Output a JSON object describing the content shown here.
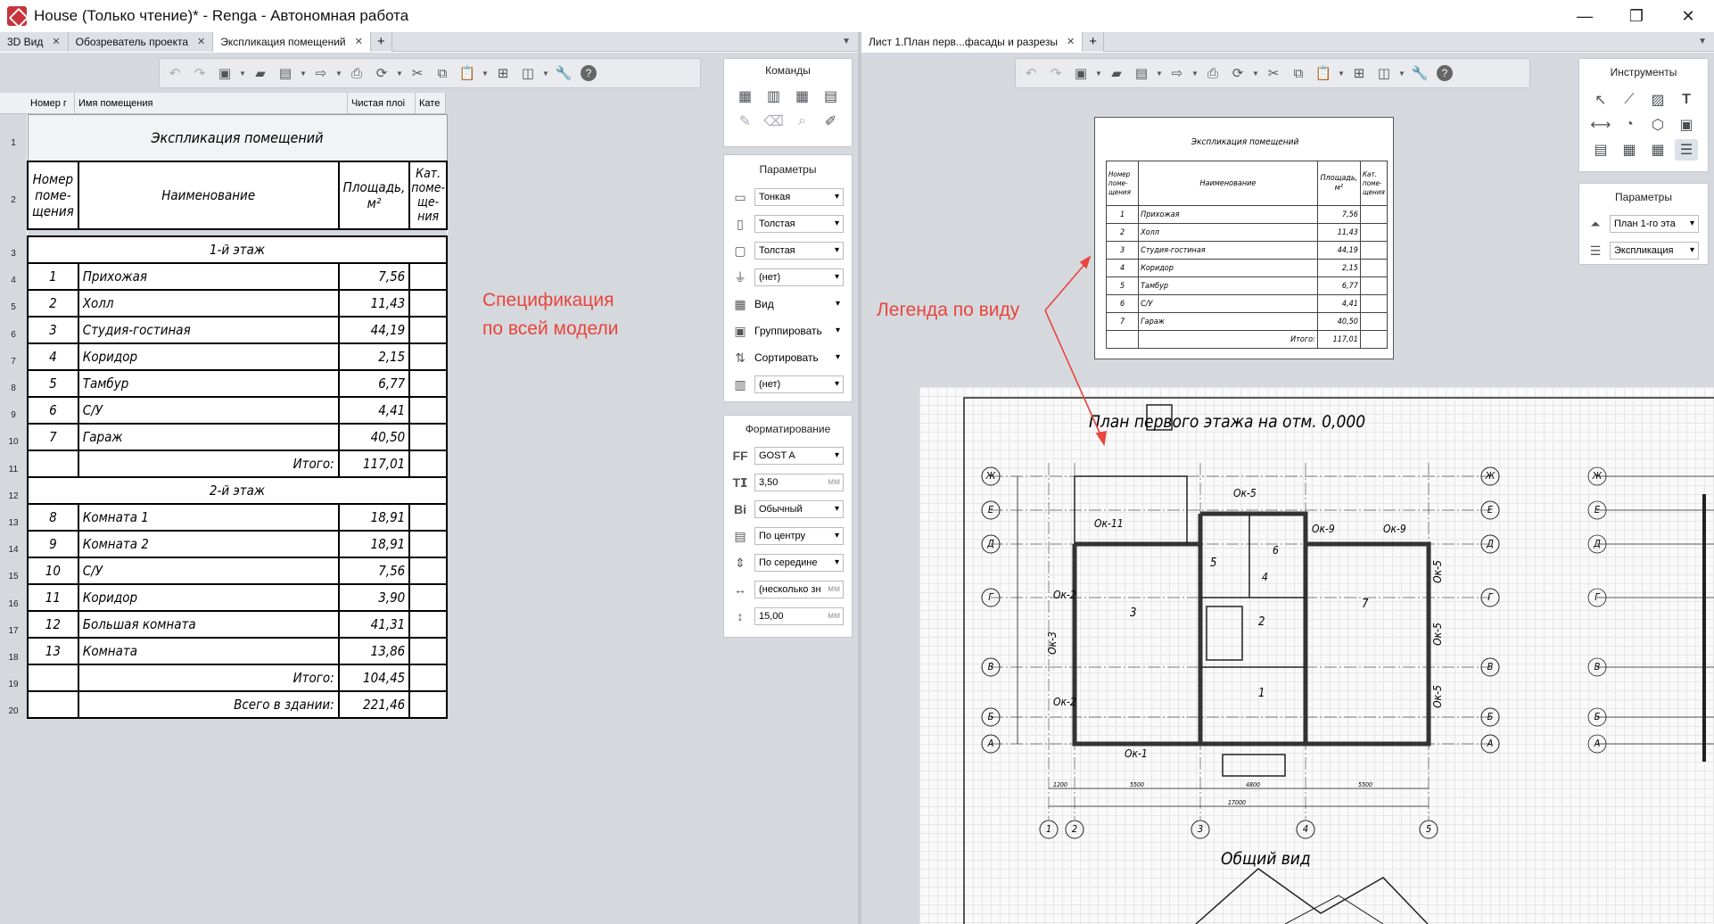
{
  "window": {
    "title": "House (Только чтение)* - Renga - Автономная работа"
  },
  "tabs_left": [
    {
      "label": "3D Вид"
    },
    {
      "label": "Обозреватель проекта"
    },
    {
      "label": "Экспликация помещений"
    }
  ],
  "tabs_right": [
    {
      "label": "Лист 1.План перв...фасады и разрезы"
    }
  ],
  "sheet": {
    "columns": [
      "Номер г",
      "Имя помещения",
      "Чистая плоі",
      "Кате"
    ],
    "row_numbers": [
      "1",
      "2",
      "3",
      "4",
      "5",
      "6",
      "7",
      "8",
      "9",
      "10",
      "11",
      "12",
      "13",
      "14",
      "15",
      "16",
      "17",
      "18",
      "19",
      "20"
    ],
    "title": "Экспликация помещений",
    "head": {
      "num": "Номер поме-щения",
      "name": "Наименование",
      "area": "Площадь, м²",
      "cat": "Кат. поме-ще-ния"
    },
    "floor1": "1-й этаж",
    "floor2": "2-й этаж",
    "rows1": [
      {
        "n": "1",
        "name": "Прихожая",
        "a": "7,56"
      },
      {
        "n": "2",
        "name": "Холл",
        "a": "11,43"
      },
      {
        "n": "3",
        "name": "Студия-гостиная",
        "a": "44,19"
      },
      {
        "n": "4",
        "name": "Коридор",
        "a": "2,15"
      },
      {
        "n": "5",
        "name": "Тамбур",
        "a": "6,77"
      },
      {
        "n": "6",
        "name": "С/У",
        "a": "4,41"
      },
      {
        "n": "7",
        "name": "Гараж",
        "a": "40,50"
      }
    ],
    "total1": {
      "label": "Итого:",
      "a": "117,01"
    },
    "rows2": [
      {
        "n": "8",
        "name": "Комната 1",
        "a": "18,91"
      },
      {
        "n": "9",
        "name": "Комната 2",
        "a": "18,91"
      },
      {
        "n": "10",
        "name": "С/У",
        "a": "7,56"
      },
      {
        "n": "11",
        "name": "Коридор",
        "a": "3,90"
      },
      {
        "n": "12",
        "name": "Большая комната",
        "a": "41,31"
      },
      {
        "n": "13",
        "name": "Комната",
        "a": "13,86"
      }
    ],
    "total2": {
      "label": "Итого:",
      "a": "104,45"
    },
    "grand": {
      "label": "Всего в здании:",
      "a": "221,46"
    }
  },
  "annotations": {
    "spec_line1": "Спецификация",
    "spec_line2": "по всей модели",
    "legend_label": "Легенда по виду"
  },
  "commands_panel": {
    "title": "Команды"
  },
  "params_panel": {
    "title": "Параметры",
    "line1": "Тонкая",
    "line2": "Толстая",
    "line3": "Толстая",
    "filter": "(нет)",
    "view": "Вид",
    "group": "Группировать",
    "sort": "Сортировать",
    "style": "(нет)"
  },
  "format_panel": {
    "title": "Форматирование",
    "font": "GOST A",
    "size": "3,50",
    "size_unit": "мм",
    "weight": "Обычный",
    "halign": "По центру",
    "valign": "По середине",
    "width": "(несколько зн",
    "width_unit": "мм",
    "height": "15,00",
    "height_unit": "мм"
  },
  "tools_panel": {
    "title": "Инструменты"
  },
  "params_right": {
    "title": "Параметры",
    "level": "План 1-го эта",
    "legend": "Экспликация"
  },
  "legend": {
    "title": "Экспликация помещений",
    "head": {
      "num": "Номер поме-щения",
      "name": "Наименование",
      "area": "Площадь, м²",
      "cat": "Кат. поме-щения"
    },
    "rows": [
      {
        "n": "1",
        "name": "Прихожая",
        "a": "7,56"
      },
      {
        "n": "2",
        "name": "Холл",
        "a": "11,43"
      },
      {
        "n": "3",
        "name": "Студия-гостиная",
        "a": "44,19"
      },
      {
        "n": "4",
        "name": "Коридор",
        "a": "2,15"
      },
      {
        "n": "5",
        "name": "Тамбур",
        "a": "6,77"
      },
      {
        "n": "6",
        "name": "С/У",
        "a": "4,41"
      },
      {
        "n": "7",
        "name": "Гараж",
        "a": "40,50"
      }
    ],
    "total": {
      "label": "Итого:",
      "a": "117,01"
    }
  },
  "drawing": {
    "plan_title": "План первого этажа на отм. 0,000",
    "view_title": "Общий вид",
    "axes_rows": [
      "Ж",
      "Е",
      "Д",
      "Г",
      "В",
      "Б",
      "А"
    ],
    "axes_cols": [
      "1",
      "2",
      "3",
      "4",
      "5"
    ],
    "windows": {
      "ok5": "Ок-5",
      "ok11": "Ок-11",
      "ok9": "Ок-9",
      "ok9b": "Ок-9",
      "ok2": "Ок-2",
      "ok3": "Ок-3",
      "ok2b": "Ок-2",
      "ok1": "Ок-1",
      "ok5v1": "Ок-5",
      "ok5v2": "Ок-5",
      "ok5v3": "Ок-5"
    },
    "rooms": {
      "r3": "3",
      "r7": "7",
      "r5": "5",
      "r6": "6",
      "r4": "4",
      "r2": "2",
      "r1": "1"
    },
    "dims": {
      "d1": "1200",
      "d2": "5500",
      "d3": "4800",
      "d4": "5500",
      "total": "17000"
    }
  },
  "colors": {
    "accent": "#e8453c",
    "pane": "#d5d9de"
  }
}
